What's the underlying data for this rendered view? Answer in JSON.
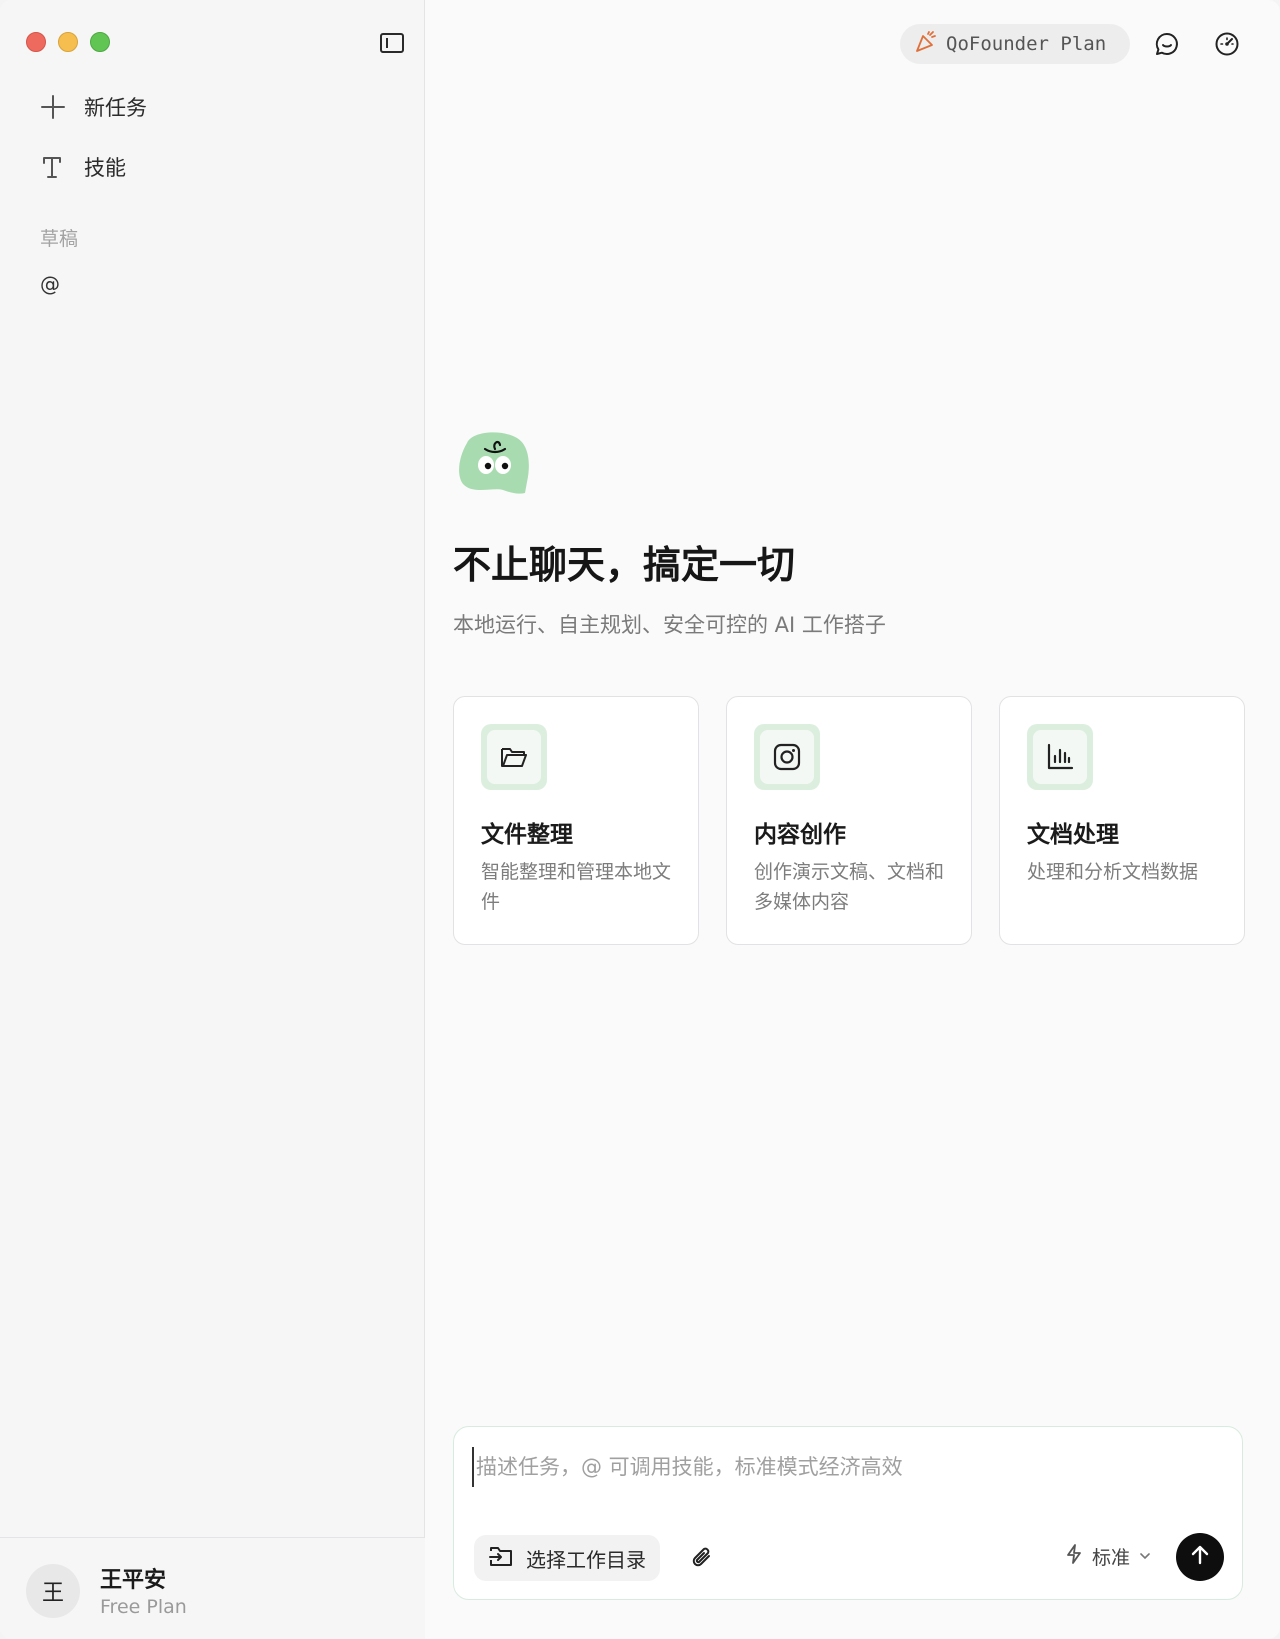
{
  "sidebar": {
    "new_task_label": "新任务",
    "skills_label": "技能",
    "drafts_section": "草稿",
    "draft_items": [
      "@"
    ]
  },
  "user": {
    "avatar_text": "王",
    "name": "王平安",
    "plan": "Free Plan"
  },
  "topbar": {
    "plan_badge": "QoFounder Plan"
  },
  "hero": {
    "title": "不止聊天，搞定一切",
    "subtitle": "本地运行、自主规划、安全可控的 AI 工作搭子"
  },
  "cards": [
    {
      "icon": "folder-open-icon",
      "title": "文件整理",
      "desc": "智能整理和管理本地文件"
    },
    {
      "icon": "instagram-icon",
      "title": "内容创作",
      "desc": "创作演示文稿、文档和多媒体内容"
    },
    {
      "icon": "bar-chart-icon",
      "title": "文档处理",
      "desc": "处理和分析文档数据"
    }
  ],
  "composer": {
    "placeholder": "描述任务，@ 可调用技能，标准模式经济高效",
    "dir_button_label": "选择工作目录",
    "mode_label": "标准"
  },
  "colors": {
    "accent_green": "#a8dcb0",
    "card_icon_bg": "#dcefde",
    "send_button": "#0e0e0e"
  }
}
